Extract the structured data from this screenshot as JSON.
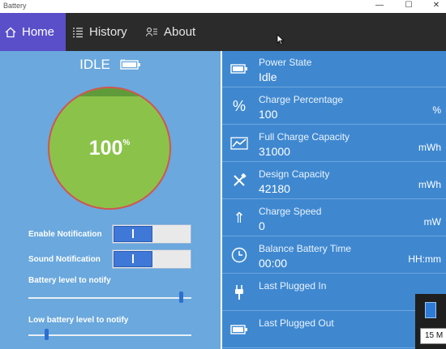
{
  "window": {
    "title": "Battery"
  },
  "nav": {
    "home": "Home",
    "history": "History",
    "about": "About"
  },
  "left": {
    "state": "IDLE",
    "percentage": "100",
    "percent_sign": "%",
    "enable_notification": "Enable Notification",
    "sound_notification": "Sound Notification",
    "battery_level_label": "Battery level to notify",
    "battery_level_value": 0.95,
    "low_battery_label": "Low battery level to notify",
    "low_battery_value": 0.1
  },
  "rows": [
    {
      "label": "Power State",
      "value": "Idle",
      "unit": "",
      "icon": "battery-icon"
    },
    {
      "label": "Charge Percentage",
      "value": "100",
      "unit": "%",
      "icon": "percent-icon"
    },
    {
      "label": "Full Charge Capacity",
      "value": "31000",
      "unit": "mWh",
      "icon": "chart-icon"
    },
    {
      "label": "Design Capacity",
      "value": "42180",
      "unit": "mWh",
      "icon": "tools-icon"
    },
    {
      "label": "Charge Speed",
      "value": "0",
      "unit": "mW",
      "icon": "arrow-up-icon"
    },
    {
      "label": "Balance Battery Time",
      "value": "00:00",
      "unit": "HH:mm",
      "icon": "clock-icon"
    },
    {
      "label": "Last Plugged In",
      "value": "",
      "unit": "",
      "icon": "plug-icon"
    },
    {
      "label": "Last Plugged Out",
      "value": "",
      "unit": "",
      "icon": "battery-icon"
    }
  ],
  "tray": {
    "time": "15 M"
  },
  "colors": {
    "accent": "#5a4fc9",
    "nav_bg": "#2b2b2b",
    "left_bg": "#6aa8dd",
    "right_bg": "#3f88d0",
    "gauge_fill": "#8bc34a",
    "gauge_border": "#d2554d"
  }
}
